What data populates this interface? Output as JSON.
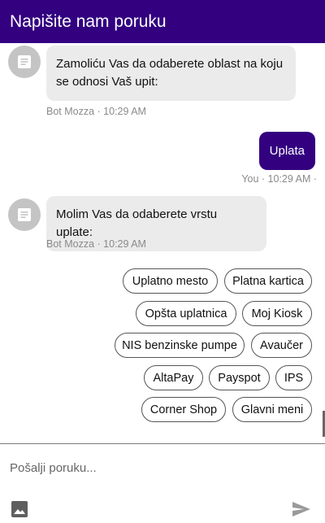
{
  "header": {
    "title": "Napišite nam poruku"
  },
  "messages": [
    {
      "sender": "bot",
      "text": "Zamoliću Vas da odaberete oblast na koju se odnosi Vaš upit:",
      "meta": "Bot Mozza · 10:29 AM"
    },
    {
      "sender": "user",
      "text": "Uplata",
      "meta": "You · 10:29 AM ·"
    },
    {
      "sender": "bot",
      "text": "Molim Vas da odaberete vrstu uplate:",
      "meta": "Bot Mozza · 10:29 AM"
    }
  ],
  "quick_replies": [
    "Uplatno mesto",
    "Platna kartica",
    "Opšta uplatnica",
    "Moj Kiosk",
    "NIS benzinske pumpe",
    "Avaučer",
    "AltaPay",
    "Payspot",
    "IPS",
    "Corner Shop",
    "Glavni meni"
  ],
  "composer": {
    "placeholder": "Pošalji poruku..."
  },
  "icons": {
    "avatar": "document-icon",
    "attach": "image-icon",
    "send": "send-icon"
  },
  "colors": {
    "brand": "#330080",
    "bot_bubble": "#ebebeb",
    "meta": "#8a8a8a"
  }
}
